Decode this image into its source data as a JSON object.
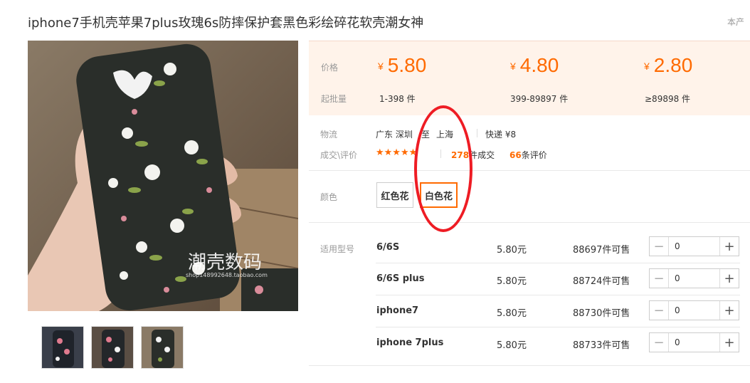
{
  "product": {
    "title": "iphone7手机壳苹果7plus玫瑰6s防摔保护套黑色彩绘碎花软壳潮女神",
    "topright_text": "本产",
    "watermark": "潮壳数码 shop148992648.taobao.com"
  },
  "pricing": {
    "price_label": "价格",
    "moq_label": "起批量",
    "currency": "¥",
    "tiers": [
      {
        "price": "5.80",
        "qty": "1-398 件"
      },
      {
        "price": "4.80",
        "qty": "399-89897 件"
      },
      {
        "price": "2.80",
        "qty": "≥89898 件"
      }
    ]
  },
  "logistics": {
    "label": "物流",
    "from": "广东 深圳",
    "to_word": "至",
    "to": "上海",
    "express": "快递 ¥8"
  },
  "reviews": {
    "label": "成交\\评价",
    "stars": "★★★★★",
    "rating": 5,
    "deals_count": "278",
    "deals_suffix": "件成交",
    "review_count": "66",
    "review_suffix": "条评价"
  },
  "colors": {
    "label": "颜色",
    "options": [
      "红色花",
      "白色花"
    ],
    "selected": "白色花"
  },
  "models": {
    "label": "适用型号",
    "rows": [
      {
        "name": "6/6S",
        "price": "5.80元",
        "stock": "88697件可售",
        "qty": "0"
      },
      {
        "name": "6/6S plus",
        "price": "5.80元",
        "stock": "88724件可售",
        "qty": "0"
      },
      {
        "name": "iphone7",
        "price": "5.80元",
        "stock": "88730件可售",
        "qty": "0"
      },
      {
        "name": "iphone 7plus",
        "price": "5.80元",
        "stock": "88733件可售",
        "qty": "0"
      }
    ]
  },
  "icons": {
    "minus": "minus-icon",
    "plus": "plus-icon",
    "star": "star-icon"
  },
  "theme": {
    "accent": "#ff6a00",
    "price_bg": "#fff3ea",
    "annotation": "#ee1c24"
  }
}
